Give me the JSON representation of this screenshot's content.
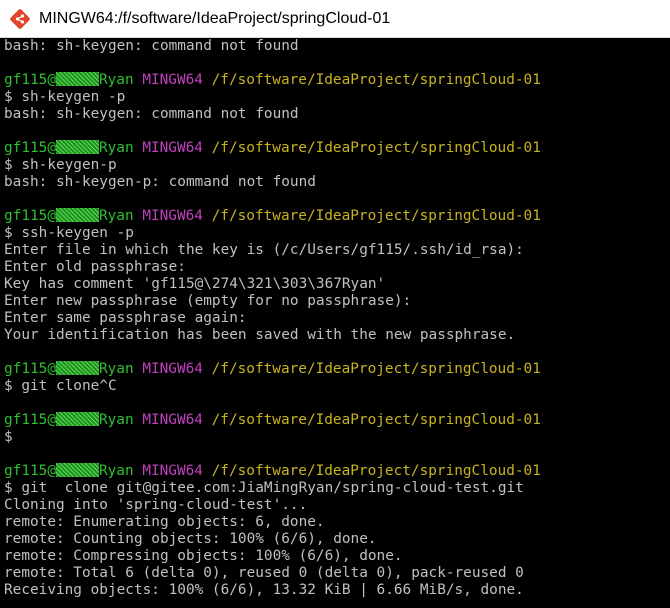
{
  "window": {
    "title": "MINGW64:/f/software/IdeaProject/springCloud-01",
    "icon": "git-bash-icon",
    "accent": "#e0442c"
  },
  "colors": {
    "background": "#000000",
    "text": "#c0c0c0",
    "user": "#2fbf2f",
    "host": "#c23fbf",
    "path": "#c8b420"
  },
  "prompt": {
    "user_prefix": "gf115@",
    "user_suffix": "Ryan",
    "host": "MINGW64",
    "path": "/f/software/IdeaProject/springCloud-01"
  },
  "terminal": {
    "lines": [
      {
        "type": "out",
        "text": "bash: sh-keygen: command not found"
      },
      {
        "type": "blank",
        "text": ""
      },
      {
        "type": "prompt"
      },
      {
        "type": "out",
        "text": "$ sh-keygen -p"
      },
      {
        "type": "out",
        "text": "bash: sh-keygen: command not found"
      },
      {
        "type": "blank",
        "text": ""
      },
      {
        "type": "prompt"
      },
      {
        "type": "out",
        "text": "$ sh-keygen-p"
      },
      {
        "type": "out",
        "text": "bash: sh-keygen-p: command not found"
      },
      {
        "type": "blank",
        "text": ""
      },
      {
        "type": "prompt"
      },
      {
        "type": "out",
        "text": "$ ssh-keygen -p"
      },
      {
        "type": "out",
        "text": "Enter file in which the key is (/c/Users/gf115/.ssh/id_rsa):"
      },
      {
        "type": "out",
        "text": "Enter old passphrase:"
      },
      {
        "type": "out",
        "text": "Key has comment 'gf115@\\274\\321\\303\\367Ryan'"
      },
      {
        "type": "out",
        "text": "Enter new passphrase (empty for no passphrase):"
      },
      {
        "type": "out",
        "text": "Enter same passphrase again:"
      },
      {
        "type": "out",
        "text": "Your identification has been saved with the new passphrase."
      },
      {
        "type": "blank",
        "text": ""
      },
      {
        "type": "prompt"
      },
      {
        "type": "out",
        "text": "$ git clone^C"
      },
      {
        "type": "blank",
        "text": ""
      },
      {
        "type": "prompt"
      },
      {
        "type": "out",
        "text": "$"
      },
      {
        "type": "blank",
        "text": ""
      },
      {
        "type": "prompt"
      },
      {
        "type": "out",
        "text": "$ git  clone git@gitee.com:JiaMingRyan/spring-cloud-test.git"
      },
      {
        "type": "out",
        "text": "Cloning into 'spring-cloud-test'..."
      },
      {
        "type": "out",
        "text": "remote: Enumerating objects: 6, done."
      },
      {
        "type": "out",
        "text": "remote: Counting objects: 100% (6/6), done."
      },
      {
        "type": "out",
        "text": "remote: Compressing objects: 100% (6/6), done."
      },
      {
        "type": "out",
        "text": "remote: Total 6 (delta 0), reused 0 (delta 0), pack-reused 0"
      },
      {
        "type": "out",
        "text": "Receiving objects: 100% (6/6), 13.32 KiB | 6.66 MiB/s, done."
      }
    ]
  }
}
